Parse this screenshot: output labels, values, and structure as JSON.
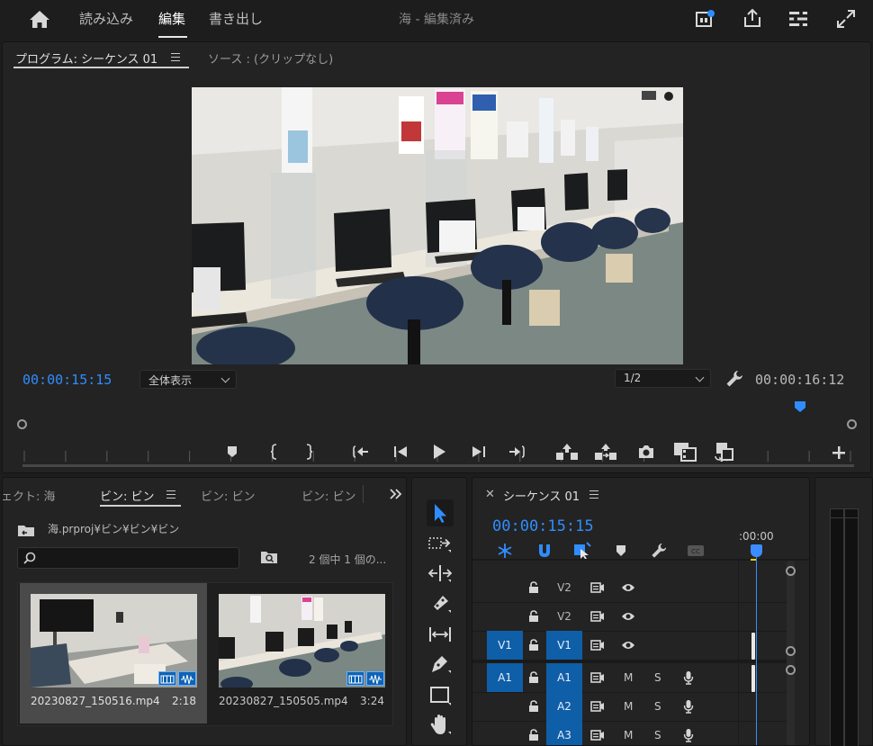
{
  "topbar": {
    "nav": [
      "読み込み",
      "編集",
      "書き出し"
    ],
    "project_name": "海",
    "separator": " - ",
    "status": "編集済み"
  },
  "program": {
    "tab_label": "プログラム: シーケンス 01",
    "source_tab_label": "ソース : (クリップなし)",
    "timecode_current": "00:00:15:15",
    "zoom_option": "全体表示",
    "resolution_option": "1/2",
    "timecode_duration": "00:00:16:12",
    "playhead_fraction": 0.935
  },
  "project": {
    "tabs": [
      "ェクト: 海",
      "ビン: ビン",
      "ビン: ビン",
      "ビン: ビン"
    ],
    "path": "海.prproj¥ビン¥ビン¥ビン",
    "item_count": "2 個中 1 個の...",
    "clips": [
      {
        "name": "20230827_150516.mp4",
        "duration": "2:18",
        "selected": true
      },
      {
        "name": "20230827_150505.mp4",
        "duration": "3:24",
        "selected": false
      }
    ]
  },
  "timeline": {
    "sequence_name": "シーケンス 01",
    "timecode": "00:00:15:15",
    "ruler_label": ":00:00",
    "tracks": [
      {
        "label": "V2",
        "kind": "video",
        "target": "",
        "active": false
      },
      {
        "label": "V2",
        "kind": "video",
        "target": "",
        "active": false
      },
      {
        "label": "V1",
        "kind": "video",
        "target": "V1",
        "active": true
      },
      {
        "label": "A1",
        "kind": "audio",
        "target": "A1",
        "active": true
      },
      {
        "label": "A2",
        "kind": "audio",
        "target": "",
        "active": true
      },
      {
        "label": "A3",
        "kind": "audio",
        "target": "",
        "active": true
      }
    ],
    "mute_label": "M",
    "solo_label": "S"
  },
  "colors": {
    "accent_blue": "#2f8dff",
    "track_target_blue": "#0f5ea8",
    "panel_bg": "#232323",
    "app_bg": "#1d1d1d"
  },
  "icons": [
    "home-icon",
    "notification-icon",
    "share-icon",
    "workspaces-icon",
    "fullscreen-icon",
    "wrench-icon",
    "marker-icon",
    "mark-in-icon",
    "mark-out-icon",
    "go-to-in-icon",
    "step-back-icon",
    "play-icon",
    "step-forward-icon",
    "go-to-out-icon",
    "lift-icon",
    "extract-icon",
    "camera-icon",
    "compare-icon",
    "trim-icon",
    "add-icon",
    "search-icon",
    "new-bin-icon",
    "selection-tool-icon",
    "track-select-tool-icon",
    "ripple-edit-tool-icon",
    "razor-tool-icon",
    "slip-tool-icon",
    "pen-tool-icon",
    "rectangle-tool-icon",
    "hand-tool-icon",
    "lock-icon",
    "eye-icon",
    "mic-icon",
    "film-icon",
    "snap-icon",
    "magnet-icon",
    "linked-selection-icon",
    "add-marker-icon",
    "settings-icon",
    "captions-icon"
  ]
}
